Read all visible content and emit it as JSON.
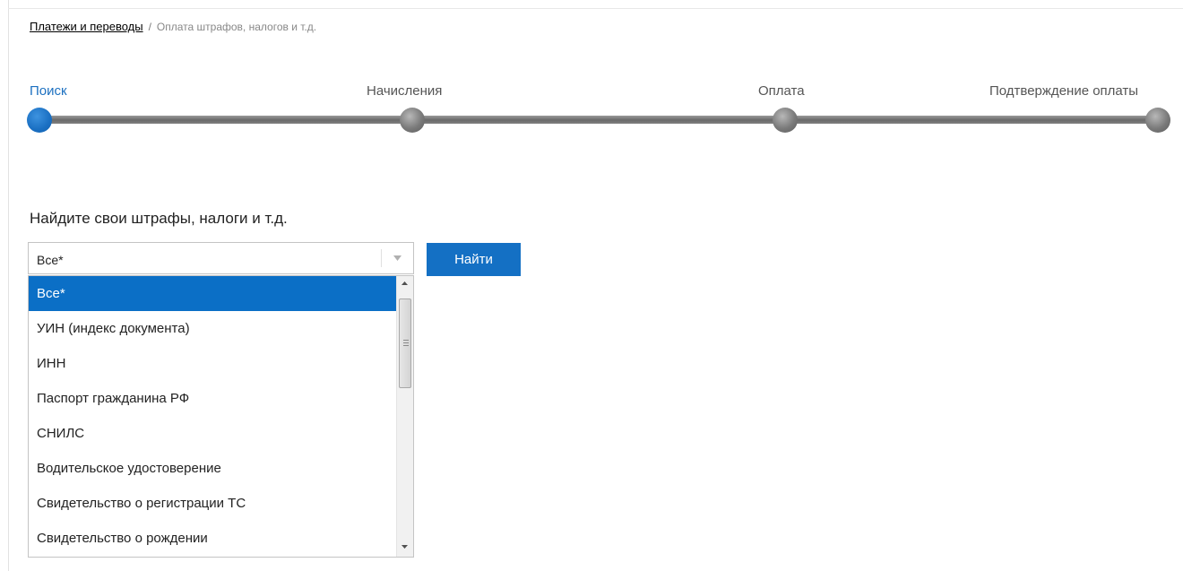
{
  "breadcrumb": {
    "parent": "Платежи и переводы",
    "separator": "/",
    "current": "Оплата штрафов, налогов и т.д."
  },
  "steps": [
    {
      "label": "Поиск",
      "active": true
    },
    {
      "label": "Начисления",
      "active": false
    },
    {
      "label": "Оплата",
      "active": false
    },
    {
      "label": "Подтверждение оплаты",
      "active": false
    }
  ],
  "search": {
    "title": "Найдите свои штрафы, налоги и т.д.",
    "selected_value": "Все*",
    "button_label": "Найти"
  },
  "dropdown": {
    "options": [
      "Все*",
      "УИН (индекс документа)",
      "ИНН",
      "Паспорт гражданина РФ",
      "СНИЛС",
      "Водительское удостоверение",
      "Свидетельство о регистрации ТС",
      "Свидетельство о рождении"
    ],
    "selected_index": 0
  },
  "colors": {
    "accent": "#1470c4",
    "active_step_text": "#1c70c0",
    "selected_option_bg": "#0b6fc6"
  },
  "icons": {
    "select_arrow": "chevron-down-icon",
    "scroll_up": "scroll-up-arrow-icon",
    "scroll_down": "scroll-down-arrow-icon"
  }
}
